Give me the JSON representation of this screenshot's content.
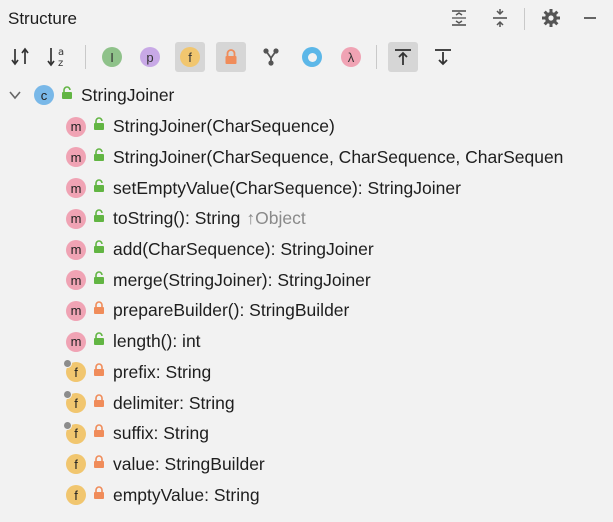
{
  "panel": {
    "title": "Structure"
  },
  "header_buttons": [
    {
      "name": "expand-all-icon"
    },
    {
      "name": "collapse-all-icon"
    },
    {
      "name": "gear-icon"
    },
    {
      "name": "minimize-icon"
    }
  ],
  "toolbar": {
    "buttons": [
      {
        "name": "sort-by-visibility-icon",
        "label": ""
      },
      {
        "name": "sort-alphabetically-icon",
        "label": "a z"
      },
      {
        "name": "show-inherited-icon",
        "label": "I"
      },
      {
        "name": "show-properties-icon",
        "label": "p"
      },
      {
        "name": "show-fields-icon",
        "label": "f"
      },
      {
        "name": "show-non-public-icon",
        "label": ""
      },
      {
        "name": "group-methods-icon",
        "label": ""
      },
      {
        "name": "show-anonymous-icon",
        "label": ""
      },
      {
        "name": "show-lambdas-icon",
        "label": "λ"
      },
      {
        "name": "autoscroll-to-source-icon",
        "label": ""
      },
      {
        "name": "autoscroll-from-source-icon",
        "label": ""
      }
    ],
    "active": [
      "f",
      "lock",
      "autoscroll-to-source"
    ]
  },
  "tree": {
    "root": {
      "kind": "c",
      "label": "StringJoiner",
      "expanded": true
    },
    "members": [
      {
        "kind": "m",
        "visibility": "public",
        "label": "StringJoiner(CharSequence)",
        "inherited": ""
      },
      {
        "kind": "m",
        "visibility": "public",
        "label": "StringJoiner(CharSequence, CharSequence, CharSequen",
        "inherited": ""
      },
      {
        "kind": "m",
        "visibility": "public",
        "label": "setEmptyValue(CharSequence): StringJoiner",
        "inherited": ""
      },
      {
        "kind": "m",
        "visibility": "public",
        "label": "toString(): String",
        "inherited": "↑Object"
      },
      {
        "kind": "m",
        "visibility": "public",
        "label": "add(CharSequence): StringJoiner",
        "inherited": ""
      },
      {
        "kind": "m",
        "visibility": "public",
        "label": "merge(StringJoiner): StringJoiner",
        "inherited": ""
      },
      {
        "kind": "m",
        "visibility": "private",
        "label": "prepareBuilder(): StringBuilder",
        "inherited": ""
      },
      {
        "kind": "m",
        "visibility": "public",
        "label": "length(): int",
        "inherited": ""
      },
      {
        "kind": "f",
        "visibility": "private",
        "final": true,
        "label": "prefix: String",
        "inherited": ""
      },
      {
        "kind": "f",
        "visibility": "private",
        "final": true,
        "label": "delimiter: String",
        "inherited": ""
      },
      {
        "kind": "f",
        "visibility": "private",
        "final": true,
        "label": "suffix: String",
        "inherited": ""
      },
      {
        "kind": "f",
        "visibility": "private",
        "final": false,
        "label": "value: StringBuilder",
        "inherited": ""
      },
      {
        "kind": "f",
        "visibility": "private",
        "final": false,
        "label": "emptyValue: String",
        "inherited": ""
      }
    ]
  },
  "colors": {
    "public_lock": "#62b543",
    "private_lock": "#f08c5a",
    "method_badge": "#f0a3b4",
    "field_badge": "#f1c66f",
    "class_badge": "#79b8e8"
  }
}
